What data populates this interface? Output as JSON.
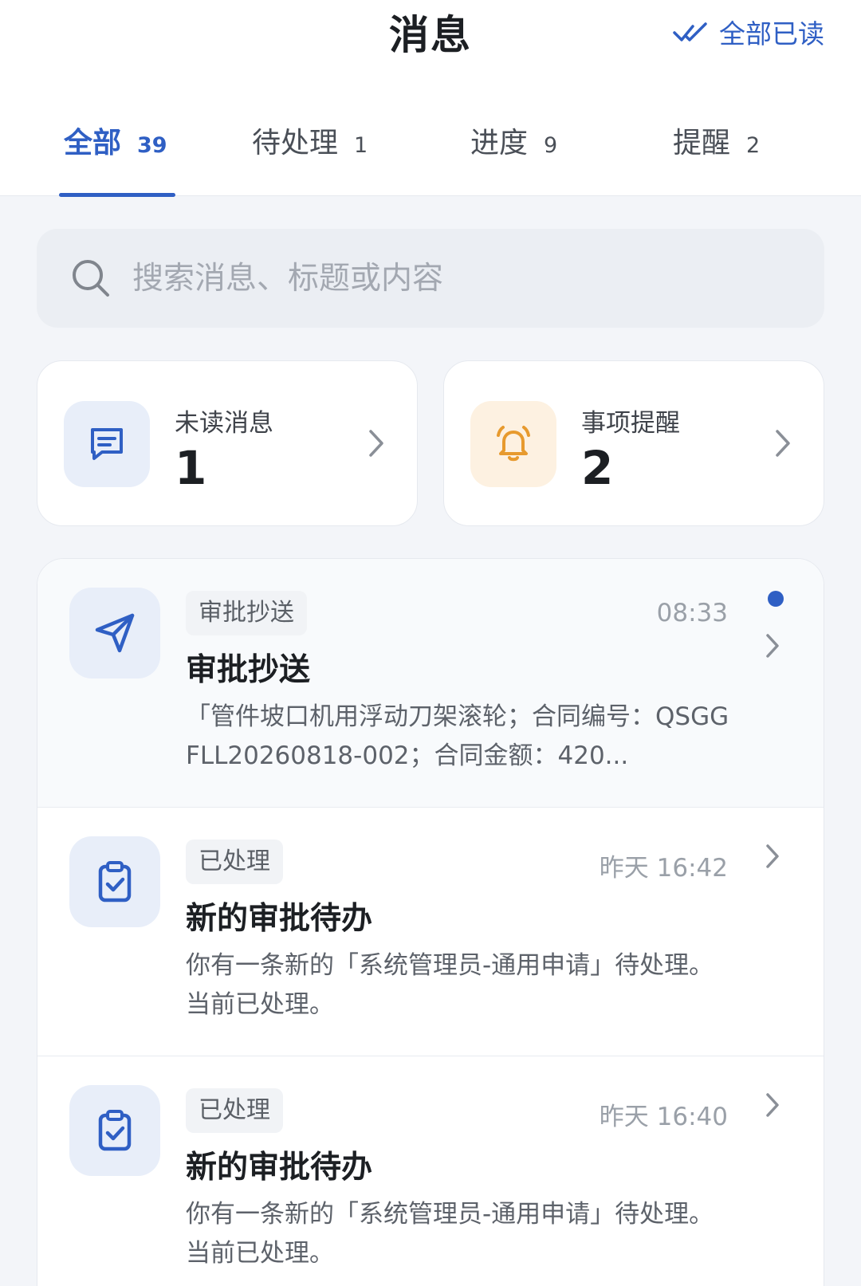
{
  "header": {
    "title": "消息",
    "read_all_label": "全部已读"
  },
  "tabs": [
    {
      "label": "全部",
      "count": "39"
    },
    {
      "label": "待处理",
      "count": "1"
    },
    {
      "label": "进度",
      "count": "9"
    },
    {
      "label": "提醒",
      "count": "2"
    }
  ],
  "search": {
    "placeholder": "搜索消息、标题或内容"
  },
  "summary": [
    {
      "label": "未读消息",
      "value": "1",
      "icon": "message-icon"
    },
    {
      "label": "事项提醒",
      "value": "2",
      "icon": "bell-icon"
    }
  ],
  "messages": [
    {
      "tag": "审批抄送",
      "time": "08:33",
      "title": "审批抄送",
      "desc": "「管件坡口机用浮动刀架滚轮；合同编号：QSGGFLL20260818-002；合同金额：420...",
      "icon": "send-icon",
      "unread": true
    },
    {
      "tag": "已处理",
      "time": "昨天 16:42",
      "title": "新的审批待办",
      "desc": "你有一条新的「系统管理员-通用申请」待处理。 当前已处理。",
      "icon": "clipboard-check-icon",
      "unread": false
    },
    {
      "tag": "已处理",
      "time": "昨天 16:40",
      "title": "新的审批待办",
      "desc": "你有一条新的「系统管理员-通用申请」待处理。 当前已处理。",
      "icon": "clipboard-check-icon",
      "unread": false
    }
  ],
  "colors": {
    "accent": "#2f5fc4",
    "bell_orange": "#e79a2e",
    "unread_dot": "#2f5fc4"
  }
}
